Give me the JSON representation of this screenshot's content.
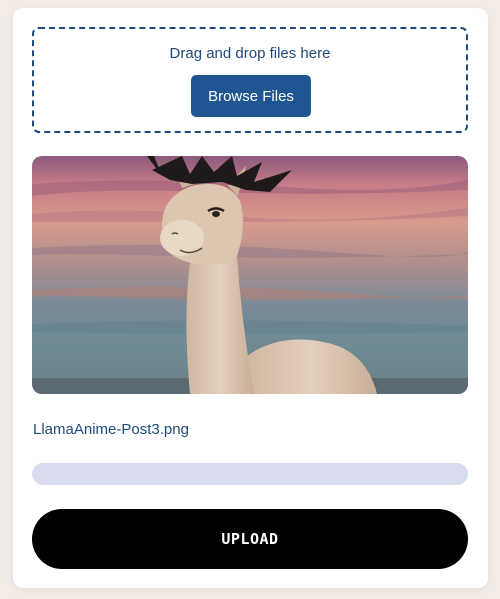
{
  "dropzone": {
    "instruction": "Drag and drop files here",
    "browse_label": "Browse Files"
  },
  "preview": {
    "image_alt_icon": "llama-anime-image"
  },
  "file": {
    "name": "LlamaAnime-Post3.png"
  },
  "progress": {
    "fraction": 0
  },
  "actions": {
    "upload_label": "UPLOAD"
  },
  "colors": {
    "accent": "#1f5592",
    "text": "#1f4a7d",
    "progress_track": "#d9dcef",
    "upload_button": "#000000"
  }
}
